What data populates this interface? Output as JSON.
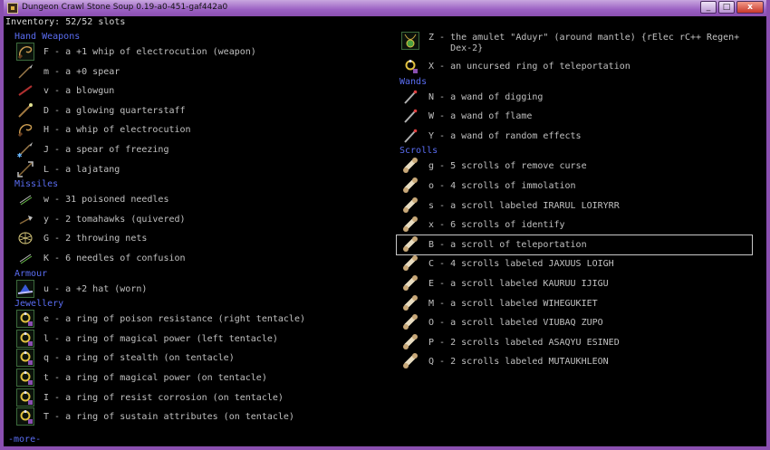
{
  "window": {
    "title": "Dungeon Crawl Stone Soup 0.19-a0-451-gaf442a0",
    "buttons": [
      "_",
      "□",
      "x"
    ]
  },
  "inventory": {
    "header": "Inventory: 52/52 slots",
    "more": "-more-",
    "left": [
      {
        "kind": "cat",
        "text": "Hand Weapons"
      },
      {
        "kind": "item",
        "icon": "whip-icon",
        "text": "F - a +1 whip of electrocution (weapon)",
        "equipped": true
      },
      {
        "kind": "item",
        "icon": "spear-icon",
        "text": "m - a +0 spear"
      },
      {
        "kind": "item",
        "icon": "blowgun-icon",
        "text": "v - a blowgun"
      },
      {
        "kind": "item",
        "icon": "quarterstaff-icon",
        "text": "D - a glowing quarterstaff"
      },
      {
        "kind": "item",
        "icon": "whip-icon",
        "text": "H - a whip of electrocution"
      },
      {
        "kind": "item",
        "icon": "frost-spear-icon",
        "text": "J - a spear of freezing"
      },
      {
        "kind": "item",
        "icon": "lajatang-icon",
        "text": "L - a lajatang"
      },
      {
        "kind": "cat",
        "text": "Missiles"
      },
      {
        "kind": "item",
        "icon": "needles-icon",
        "text": "w - 31 poisoned needles"
      },
      {
        "kind": "item",
        "icon": "tomahawk-icon",
        "text": "y - 2 tomahawks (quivered)"
      },
      {
        "kind": "item",
        "icon": "net-icon",
        "text": "G - 2 throwing nets"
      },
      {
        "kind": "item",
        "icon": "needles-icon",
        "text": "K - 6 needles of confusion"
      },
      {
        "kind": "cat",
        "text": "Armour"
      },
      {
        "kind": "item",
        "icon": "hat-icon",
        "text": "u - a +2 hat (worn)",
        "equipped": true
      },
      {
        "kind": "cat",
        "text": "Jewellery"
      },
      {
        "kind": "item",
        "icon": "ring-icon",
        "text": "e - a ring of poison resistance (right tentacle)",
        "equipped": true
      },
      {
        "kind": "item",
        "icon": "ring-icon",
        "text": "l - a ring of magical power (left tentacle)",
        "equipped": true
      },
      {
        "kind": "item",
        "icon": "ring-icon",
        "text": "q - a ring of stealth (on tentacle)",
        "equipped": true
      },
      {
        "kind": "item",
        "icon": "ring-icon",
        "text": "t - a ring of magical power (on tentacle)",
        "equipped": true
      },
      {
        "kind": "item",
        "icon": "ring-icon",
        "text": "I - a ring of resist corrosion (on tentacle)",
        "equipped": true
      },
      {
        "kind": "item",
        "icon": "ring-icon",
        "text": "T - a ring of sustain attributes (on tentacle)",
        "equipped": true
      }
    ],
    "right": [
      {
        "kind": "item",
        "icon": "amulet-icon",
        "text": "Z - the amulet \"Aduyr\" (around mantle) {rElec rC++ Regen+\n    Dex-2}",
        "equipped": true,
        "tall": true
      },
      {
        "kind": "item",
        "icon": "ring-icon",
        "text": "X - an uncursed ring of teleportation"
      },
      {
        "kind": "cat",
        "text": "Wands"
      },
      {
        "kind": "item",
        "icon": "wand-icon",
        "text": "N - a wand of digging"
      },
      {
        "kind": "item",
        "icon": "wand-icon",
        "text": "W - a wand of flame"
      },
      {
        "kind": "item",
        "icon": "wand-icon",
        "text": "Y - a wand of random effects"
      },
      {
        "kind": "cat",
        "text": "Scrolls"
      },
      {
        "kind": "item",
        "icon": "scroll-icon",
        "text": "g - 5 scrolls of remove curse"
      },
      {
        "kind": "item",
        "icon": "scroll-icon",
        "text": "o - 4 scrolls of immolation"
      },
      {
        "kind": "item",
        "icon": "scroll-icon",
        "text": "s - a scroll labeled IRARUL LOIRYRR"
      },
      {
        "kind": "item",
        "icon": "scroll-icon",
        "text": "x - 6 scrolls of identify"
      },
      {
        "kind": "item",
        "icon": "scroll-icon",
        "text": "B - a scroll of teleportation",
        "selected": true
      },
      {
        "kind": "item",
        "icon": "scroll-icon",
        "text": "C - 4 scrolls labeled JAXUUS LOIGH"
      },
      {
        "kind": "item",
        "icon": "scroll-icon",
        "text": "E - a scroll labeled KAURUU IJIGU"
      },
      {
        "kind": "item",
        "icon": "scroll-icon",
        "text": "M - a scroll labeled WIHEGUKIET"
      },
      {
        "kind": "item",
        "icon": "scroll-icon",
        "text": "O - a scroll labeled VIUBAQ ZUPO"
      },
      {
        "kind": "item",
        "icon": "scroll-icon",
        "text": "P - 2 scrolls labeled ASAQYU ESINED"
      },
      {
        "kind": "item",
        "icon": "scroll-icon",
        "text": "Q - 2 scrolls labeled MUTAUKHLEON"
      }
    ]
  },
  "colors": {
    "category": "#5a6df2",
    "item_text": "#c0c0c0",
    "frame": "#8a4fb0"
  }
}
